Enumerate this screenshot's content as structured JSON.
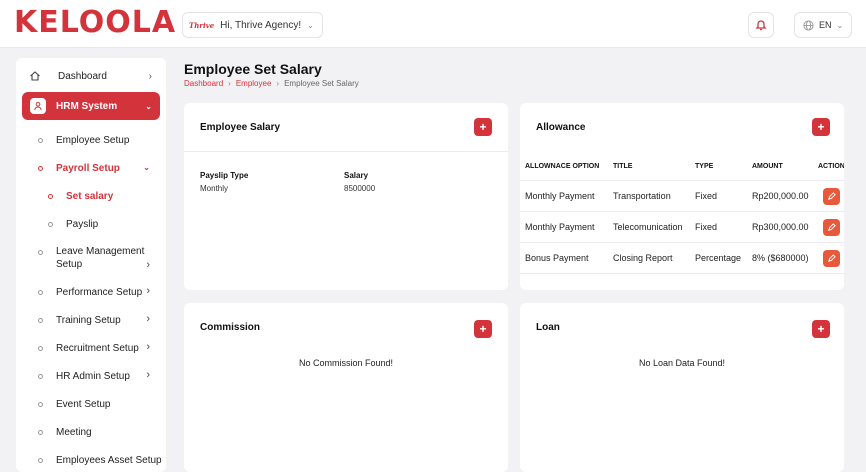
{
  "header": {
    "logo_text": "KELOOLA",
    "greeting": "Hi, Thrive Agency!",
    "brand_mark": "Thrive",
    "language": "EN"
  },
  "sidebar": {
    "dashboard": "Dashboard",
    "hrm": "HRM System",
    "items": [
      {
        "label": "Employee Setup"
      },
      {
        "label": "Payroll Setup"
      },
      {
        "label": "Set salary"
      },
      {
        "label": "Payslip"
      },
      {
        "label": "Leave Management",
        "label2": "Setup"
      },
      {
        "label": "Performance Setup"
      },
      {
        "label": "Training Setup"
      },
      {
        "label": "Recruitment Setup"
      },
      {
        "label": "HR Admin Setup"
      },
      {
        "label": "Event Setup"
      },
      {
        "label": "Meeting"
      },
      {
        "label": "Employees Asset Setup"
      }
    ]
  },
  "page": {
    "title": "Employee Set Salary",
    "breadcrumb": [
      "Dashboard",
      "Employee",
      "Employee Set Salary"
    ]
  },
  "employee_salary": {
    "title": "Employee Salary",
    "add_label": "+",
    "columns": [
      "Payslip Type",
      "Salary"
    ],
    "values": [
      "Monthly",
      "8500000"
    ]
  },
  "allowance": {
    "title": "Allowance",
    "add_label": "+",
    "columns": [
      "ALLOWNACE OPTION",
      "TITLE",
      "TYPE",
      "AMOUNT",
      "ACTION"
    ],
    "rows": [
      {
        "option": "Monthly Payment",
        "title": "Transportation",
        "type": "Fixed",
        "amount": "Rp200,000.00"
      },
      {
        "option": "Monthly Payment",
        "title": "Telecomunication",
        "type": "Fixed",
        "amount": "Rp300,000.00"
      },
      {
        "option": "Bonus Payment",
        "title": "Closing Report",
        "type": "Percentage",
        "amount": "8% ($680000)"
      }
    ]
  },
  "commission": {
    "title": "Commission",
    "add_label": "+",
    "empty": "No Commission Found!"
  },
  "loan": {
    "title": "Loan",
    "add_label": "+",
    "empty": "No Loan Data Found!"
  },
  "colors": {
    "brand": "#d3343b",
    "edit": "#e8583a",
    "background": "#f2f2f4"
  },
  "icons": [
    "home-icon",
    "user-icon",
    "chevron-right-icon",
    "chevron-down-icon",
    "bell-icon",
    "globe-icon",
    "pencil-icon",
    "plus-icon"
  ]
}
